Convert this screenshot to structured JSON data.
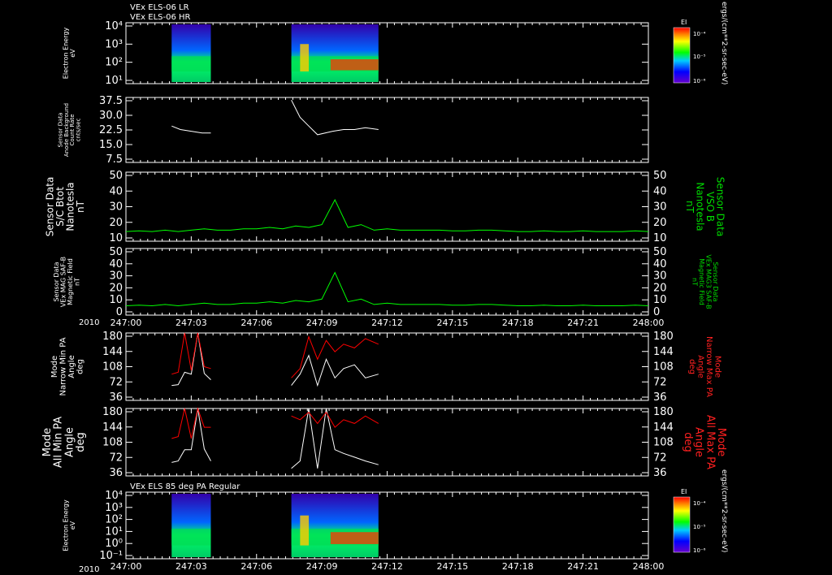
{
  "colors": {
    "background": "#000000",
    "axis": "#ffffff",
    "white_trace": "#ffffff",
    "green_trace": "#00ff00",
    "red_trace": "#ff0000",
    "green_label": "#00dd00",
    "red_label": "#ff2020"
  },
  "header": {
    "line1": "VEx ELS-06 LR",
    "line2": "VEx ELS-06 HR",
    "bottom_title": "VEx ELS 85 deg PA Regular"
  },
  "time_axis": {
    "year_label": "2010",
    "tick_labels": [
      "247:00",
      "247:03",
      "247:06",
      "247:09",
      "247:12",
      "247:15",
      "247:18",
      "247:21",
      "248:00"
    ]
  },
  "colorbar": {
    "label": "EI",
    "ticks": [
      "10⁻⁴",
      "10⁻⁵",
      "10⁻⁶"
    ],
    "unit_label": "ergs/(cm**2-sr-sec-eV)"
  },
  "chart_data": [
    {
      "panel": "electron-spectrogram-top",
      "type": "heatmap",
      "ylabel": "Electron Energy\neV",
      "y_ticks": [
        "10⁴",
        "10³",
        "10²",
        "10¹"
      ],
      "data_intervals": [
        {
          "start": "247:02.1",
          "end": "247:03.9"
        },
        {
          "start": "247:07.6",
          "end": "247:11.6"
        }
      ]
    },
    {
      "panel": "anode-background",
      "type": "line",
      "ylabel": "Sensor Data\nAnode Background\nCount Rate\ncnts/sec",
      "y_ticks": [
        "37.5",
        "30.0",
        "22.5",
        "15.0",
        "7.5"
      ],
      "ylim": [
        0,
        37.5
      ],
      "series": [
        {
          "color": "white",
          "x": [
            "247:02.1",
            "247:02.5",
            "247:03.0",
            "247:03.5",
            "247:03.9"
          ],
          "y": [
            21,
            19,
            18,
            17,
            17
          ]
        },
        {
          "color": "white",
          "x": [
            "247:07.6",
            "247:08.0",
            "247:08.4",
            "247:08.8",
            "247:09.5",
            "247:10.0",
            "247:10.5",
            "247:11.0",
            "247:11.6"
          ],
          "y": [
            36,
            26,
            21,
            16,
            18,
            19,
            19,
            20,
            19
          ]
        }
      ]
    },
    {
      "panel": "sc-bfield",
      "type": "line",
      "ylabel": "Sensor Data\nS/C Btot\nNanotesla\nnT",
      "right_label": "Sensor Data\nVSO B\nNanotesla\nnT",
      "y_ticks": [
        "50",
        "40",
        "30",
        "20",
        "10"
      ],
      "ylim": [
        0,
        50
      ],
      "x_range": [
        "247:00",
        "248:00"
      ],
      "values": [
        7,
        7.5,
        7,
        8,
        7,
        8,
        9,
        8,
        8,
        9,
        9,
        10,
        9,
        11,
        10,
        12,
        30,
        10,
        12,
        8,
        9,
        8,
        8,
        8,
        8,
        7.5,
        7.5,
        8,
        8,
        7.5,
        7,
        7,
        7.5,
        7,
        7,
        7.5,
        7,
        7,
        7,
        7.5,
        7
      ]
    },
    {
      "panel": "mag-field",
      "type": "line",
      "ylabel": "Sensor Data\nVEx MAG SAF-B\nMagnetic Field\nnT",
      "right_label": "Sensor Data\nVEx MAG3 SAF-B\nMagnetic Field\nnT",
      "y_ticks": [
        "50",
        "40",
        "30",
        "20",
        "10",
        "0"
      ],
      "ylim": [
        0,
        50
      ],
      "x_range": [
        "247:00",
        "248:00"
      ],
      "values": [
        7,
        7.5,
        7,
        8,
        7,
        8,
        9,
        8,
        8,
        9,
        9,
        10,
        9,
        11,
        10,
        12,
        32,
        10,
        12,
        8,
        9,
        8,
        8,
        8,
        8,
        7.5,
        7.5,
        8,
        8,
        7.5,
        7,
        7,
        7.5,
        7,
        7,
        7.5,
        7,
        7,
        7,
        7.5,
        7
      ]
    },
    {
      "panel": "narrow-pa",
      "type": "line",
      "ylabel": "Mode\nNarrow Min PA\nAngle\ndeg",
      "right_label": "Mode\nNarrow Max PA\nAngle\ndeg",
      "y_ticks": [
        "180",
        "144",
        "108",
        "72",
        "36"
      ],
      "ylim": [
        0,
        180
      ],
      "series": [
        {
          "name": "Min PA",
          "color": "white",
          "x": [
            "247:02.1",
            "247:02.4",
            "247:02.7",
            "247:03.0",
            "247:03.3",
            "247:03.6",
            "247:03.9",
            "",
            "247:07.6",
            "247:08.0",
            "247:08.4",
            "247:08.8",
            "247:09.2",
            "247:09.6",
            "247:10.0",
            "247:10.5",
            "247:11.0",
            "247:11.6"
          ],
          "y": [
            40,
            42,
            75,
            70,
            180,
            72,
            55,
            null,
            40,
            70,
            120,
            40,
            110,
            60,
            85,
            95,
            60,
            70
          ]
        },
        {
          "name": "Max PA",
          "color": "red",
          "x": [
            "247:02.1",
            "247:02.4",
            "247:02.7",
            "247:03.0",
            "247:03.3",
            "247:03.6",
            "247:03.9",
            "",
            "247:07.6",
            "247:08.0",
            "247:08.4",
            "247:08.8",
            "247:09.2",
            "247:09.6",
            "247:10.0",
            "247:10.5",
            "247:11.0",
            "247:11.6"
          ],
          "y": [
            70,
            75,
            180,
            80,
            180,
            90,
            85,
            null,
            60,
            85,
            170,
            110,
            160,
            130,
            150,
            140,
            165,
            150
          ]
        }
      ]
    },
    {
      "panel": "all-pa",
      "type": "line",
      "ylabel": "Mode\nAll Min PA\nAngle\ndeg",
      "right_label": "Mode\nAll Max PA\nAngle\ndeg",
      "y_ticks": [
        "180",
        "144",
        "108",
        "72",
        "36"
      ],
      "ylim": [
        0,
        180
      ],
      "series": [
        {
          "name": "Min PA",
          "color": "white",
          "x": [
            "247:02.1",
            "247:02.4",
            "247:02.7",
            "247:03.0",
            "247:03.3",
            "247:03.6",
            "247:03.9",
            "",
            "247:07.6",
            "247:08.0",
            "247:08.4",
            "247:08.8",
            "247:09.2",
            "247:09.6",
            "247:10.0",
            "247:10.5",
            "247:11.0",
            "247:11.6"
          ],
          "y": [
            36,
            40,
            70,
            70,
            180,
            72,
            40,
            null,
            20,
            40,
            180,
            20,
            180,
            70,
            60,
            50,
            40,
            30
          ]
        },
        {
          "name": "Max PA",
          "color": "red",
          "x": [
            "247:02.1",
            "247:02.4",
            "247:02.7",
            "247:03.0",
            "247:03.3",
            "247:03.6",
            "247:03.9",
            "",
            "247:07.6",
            "247:08.0",
            "247:08.4",
            "247:08.8",
            "247:09.2",
            "247:09.6",
            "247:10.0",
            "247:10.5",
            "247:11.0",
            "247:11.6"
          ],
          "y": [
            100,
            105,
            180,
            100,
            180,
            130,
            130,
            null,
            160,
            150,
            170,
            140,
            170,
            130,
            150,
            140,
            160,
            140
          ]
        }
      ]
    },
    {
      "panel": "electron-spectrogram-bottom",
      "type": "heatmap",
      "ylabel": "Electron Energy\neV",
      "y_ticks": [
        "10⁴",
        "10³",
        "10²",
        "10¹",
        "10⁰",
        "10⁻¹"
      ],
      "data_intervals": [
        {
          "start": "247:02.1",
          "end": "247:03.9"
        },
        {
          "start": "247:07.6",
          "end": "247:11.6"
        }
      ]
    }
  ]
}
